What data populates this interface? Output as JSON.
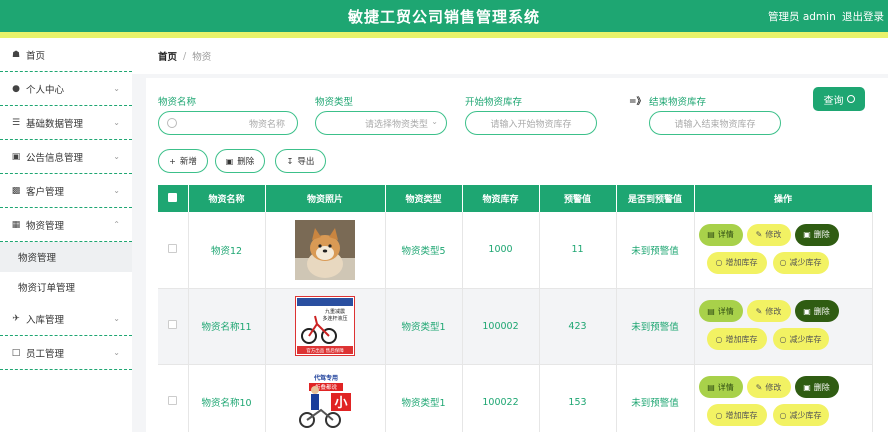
{
  "header": {
    "title": "敏捷工贸公司销售管理系统",
    "admin_label": "管理员 admin",
    "logout_label": "退出登录"
  },
  "sidebar": {
    "items": [
      {
        "label": "首页",
        "icon": "home-icon"
      },
      {
        "label": "个人中心",
        "icon": "user-icon"
      },
      {
        "label": "基础数据管理",
        "icon": "list-icon"
      },
      {
        "label": "公告信息管理",
        "icon": "doc-icon"
      },
      {
        "label": "客户管理",
        "icon": "client-icon"
      },
      {
        "label": "物资管理",
        "icon": "clipboard-icon"
      },
      {
        "label": "入库管理",
        "icon": "plane-icon"
      },
      {
        "label": "员工管理",
        "icon": "chat-icon"
      }
    ],
    "sub_items": [
      "物资管理",
      "物资订单管理"
    ]
  },
  "breadcrumb": {
    "home": "首页",
    "separator": "/",
    "current": "物资"
  },
  "filters": {
    "name_label": "物资名称",
    "name_placeholder": "物资名称",
    "type_label": "物资类型",
    "type_placeholder": "请选择物资类型",
    "start_label": "开始物资库存",
    "start_placeholder": "请输入开始物资库存",
    "range_arrow": "=》",
    "end_label": "结束物资库存",
    "end_placeholder": "请输入结束物资库存",
    "query_label": "查询"
  },
  "toolbar": {
    "add_label": "新增",
    "delete_label": "删除",
    "export_label": "导出"
  },
  "table": {
    "headers": [
      "物资名称",
      "物资照片",
      "物资类型",
      "物资库存",
      "预警值",
      "是否到预警值",
      "操作"
    ],
    "rows": [
      {
        "name": "物资12",
        "type": "物资类型5",
        "stock": "1000",
        "warn": "11",
        "status": "未到预警值"
      },
      {
        "name": "物资名称11",
        "type": "物资类型1",
        "stock": "100002",
        "warn": "423",
        "status": "未到预警值"
      },
      {
        "name": "物资名称10",
        "type": "物资类型1",
        "stock": "100022",
        "warn": "153",
        "status": "未到预警值"
      }
    ],
    "photo2_text": {
      "line1": "九重减震",
      "line2": "多连杆液压",
      "line3": "官方出品 售后保障"
    },
    "photo3_text": {
      "line1": "代驾专用",
      "line2": "折叠都说",
      "line3": "小"
    }
  },
  "row_ops": {
    "detail": "详情",
    "edit": "修改",
    "delete": "删除",
    "increase": "增加库存",
    "decrease": "减少库存"
  },
  "colors": {
    "primary": "#1ea672",
    "accent": "#e8f26a"
  }
}
